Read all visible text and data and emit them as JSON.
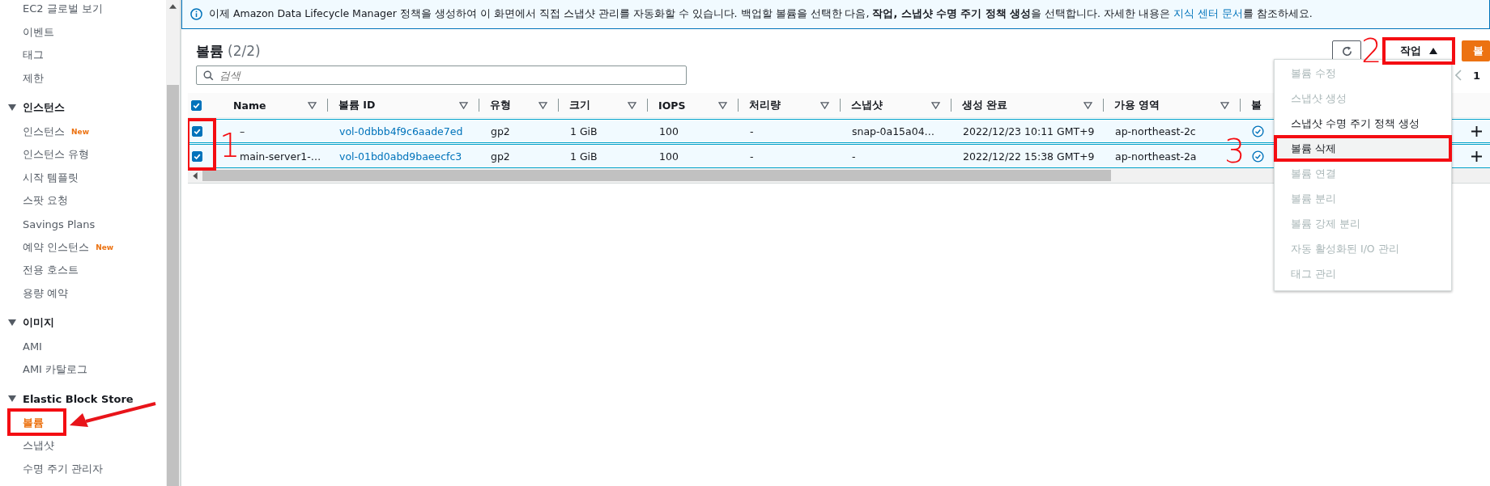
{
  "sidebar": {
    "sections": [
      {
        "items": [
          {
            "label": "EC2 글로벌 보기",
            "selected": false
          },
          {
            "label": "이벤트",
            "selected": false
          },
          {
            "label": "태그",
            "selected": false
          },
          {
            "label": "제한",
            "selected": false
          }
        ]
      },
      {
        "title": "인스턴스",
        "expanded": true,
        "items": [
          {
            "label": "인스턴스",
            "badge": "New",
            "selected": false
          },
          {
            "label": "인스턴스 유형",
            "selected": false
          },
          {
            "label": "시작 템플릿",
            "selected": false
          },
          {
            "label": "스팟 요청",
            "selected": false
          },
          {
            "label": "Savings Plans",
            "selected": false
          },
          {
            "label": "예약 인스턴스",
            "badge": "New",
            "selected": false
          },
          {
            "label": "전용 호스트",
            "selected": false
          },
          {
            "label": "용량 예약",
            "selected": false
          }
        ]
      },
      {
        "title": "이미지",
        "expanded": true,
        "items": [
          {
            "label": "AMI",
            "selected": false
          },
          {
            "label": "AMI 카탈로그",
            "selected": false
          }
        ]
      },
      {
        "title": "Elastic Block Store",
        "expanded": true,
        "items": [
          {
            "label": "볼륨",
            "selected": true,
            "callout_arrow": true
          },
          {
            "label": "스냅샷",
            "selected": false
          },
          {
            "label": "수명 주기 관리자",
            "selected": false
          }
        ]
      }
    ]
  },
  "banner": {
    "text": "이제 Amazon Data Lifecycle Manager 정책을 생성하여 이 화면에서 직접 스냅샷 관리를 자동화할 수 있습니다. 백업할 볼륨을 선택한 다음, **작업, 스냅샷 수명 주기 정책 생성**을 선택합니다. 자세한 내용은 ",
    "link": "지식 센터 문서",
    "text_after": "를 참조하세요."
  },
  "header": {
    "title": "볼륨",
    "count": "(2/2)"
  },
  "toolbar": {
    "actions": {
      "label": "작업",
      "expanded": true,
      "callout": "2"
    },
    "create": {
      "label": "볼"
    }
  },
  "search": {
    "placeholder": "검색"
  },
  "pagination": {
    "page": "1"
  },
  "table": {
    "all_checked": true,
    "callout": "1",
    "columns": [
      {
        "label": "Name"
      },
      {
        "label": "볼륨 ID"
      },
      {
        "label": "유형"
      },
      {
        "label": "크기"
      },
      {
        "label": "IOPS"
      },
      {
        "label": "처리량"
      },
      {
        "label": "스냅샷"
      },
      {
        "label": "생성 완료"
      },
      {
        "label": "가용 영역"
      },
      {
        "label": "볼"
      }
    ],
    "rows": [
      {
        "selected": true,
        "cells": [
          "–",
          "vol-0dbbb4f9c6aade7ed",
          "gp2",
          "1 GiB",
          "100",
          "-",
          "snap-0a15a04…",
          "2022/12/23 10:11 GMT+9",
          "ap-northeast-2c"
        ]
      },
      {
        "selected": true,
        "cells": [
          "main-server1-…",
          "vol-01bd0abd9baeecfc3",
          "gp2",
          "1 GiB",
          "100",
          "-",
          "-",
          "2022/12/22 15:38 GMT+9",
          "ap-northeast-2a"
        ]
      }
    ]
  },
  "menu": {
    "items": [
      {
        "label": "볼륨 수정",
        "disabled": true,
        "selected": false
      },
      {
        "label": "스냅샷 생성",
        "disabled": true,
        "selected": false
      },
      {
        "label": "스냅샷 수명 주기 정책 생성",
        "disabled": false,
        "selected": false
      },
      {
        "label": "볼륨 삭제",
        "disabled": false,
        "selected": true,
        "callout": "3"
      },
      {
        "label": "볼륨 연결",
        "disabled": true,
        "selected": false
      },
      {
        "label": "볼륨 분리",
        "disabled": true,
        "selected": false
      },
      {
        "label": "볼륨 강제 분리",
        "disabled": true,
        "selected": false
      },
      {
        "label": "자동 활성화된 I/O 관리",
        "disabled": true,
        "selected": false
      },
      {
        "label": "태그 관리",
        "disabled": true,
        "selected": false
      }
    ]
  }
}
